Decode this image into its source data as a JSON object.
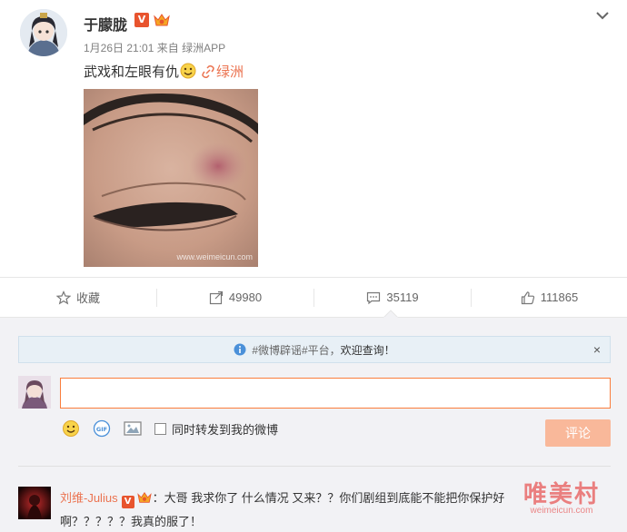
{
  "post": {
    "username": "于朦胧",
    "verified_badge": "V",
    "date": "1月26日 21:01",
    "source_prefix": "来自",
    "source": "绿洲APP",
    "text": "武戏和左眼有仇",
    "location": "绿洲",
    "photo_watermark": "www.weimeicun.com"
  },
  "actions": {
    "favorite": "收藏",
    "repost": "49980",
    "comment": "35119",
    "like": "111865"
  },
  "notice": {
    "prefix": "#微博辟谣#平台，",
    "highlight": "欢迎查询！",
    "close": "×"
  },
  "composer": {
    "repost_label": "同时转发到我的微博",
    "submit": "评论"
  },
  "comment": {
    "username": "刘维-Julius",
    "verified_badge": "V",
    "line1": "：大哥 我求你了 什么情况 又来？？你们剧组到底能不能把你保护好",
    "line2": "啊？？？？？我真的服了！"
  },
  "watermark": {
    "big": "唯美村",
    "small": "weimeicun.com"
  },
  "colors": {
    "accent": "#eb7350",
    "input_border": "#fa7d3c",
    "submit_bg": "#f9b89a",
    "notice_bg": "#e8f0f6",
    "comment_bg": "#f2f2f5"
  },
  "icons": {
    "menu": "chevron-down-icon",
    "favorite": "star-icon",
    "repost": "share-icon",
    "comment": "comment-icon",
    "like": "thumb-up-icon",
    "location": "link-icon",
    "emoji": "smile-icon",
    "gif": "gif-icon",
    "image": "image-icon",
    "notice": "info-icon"
  }
}
